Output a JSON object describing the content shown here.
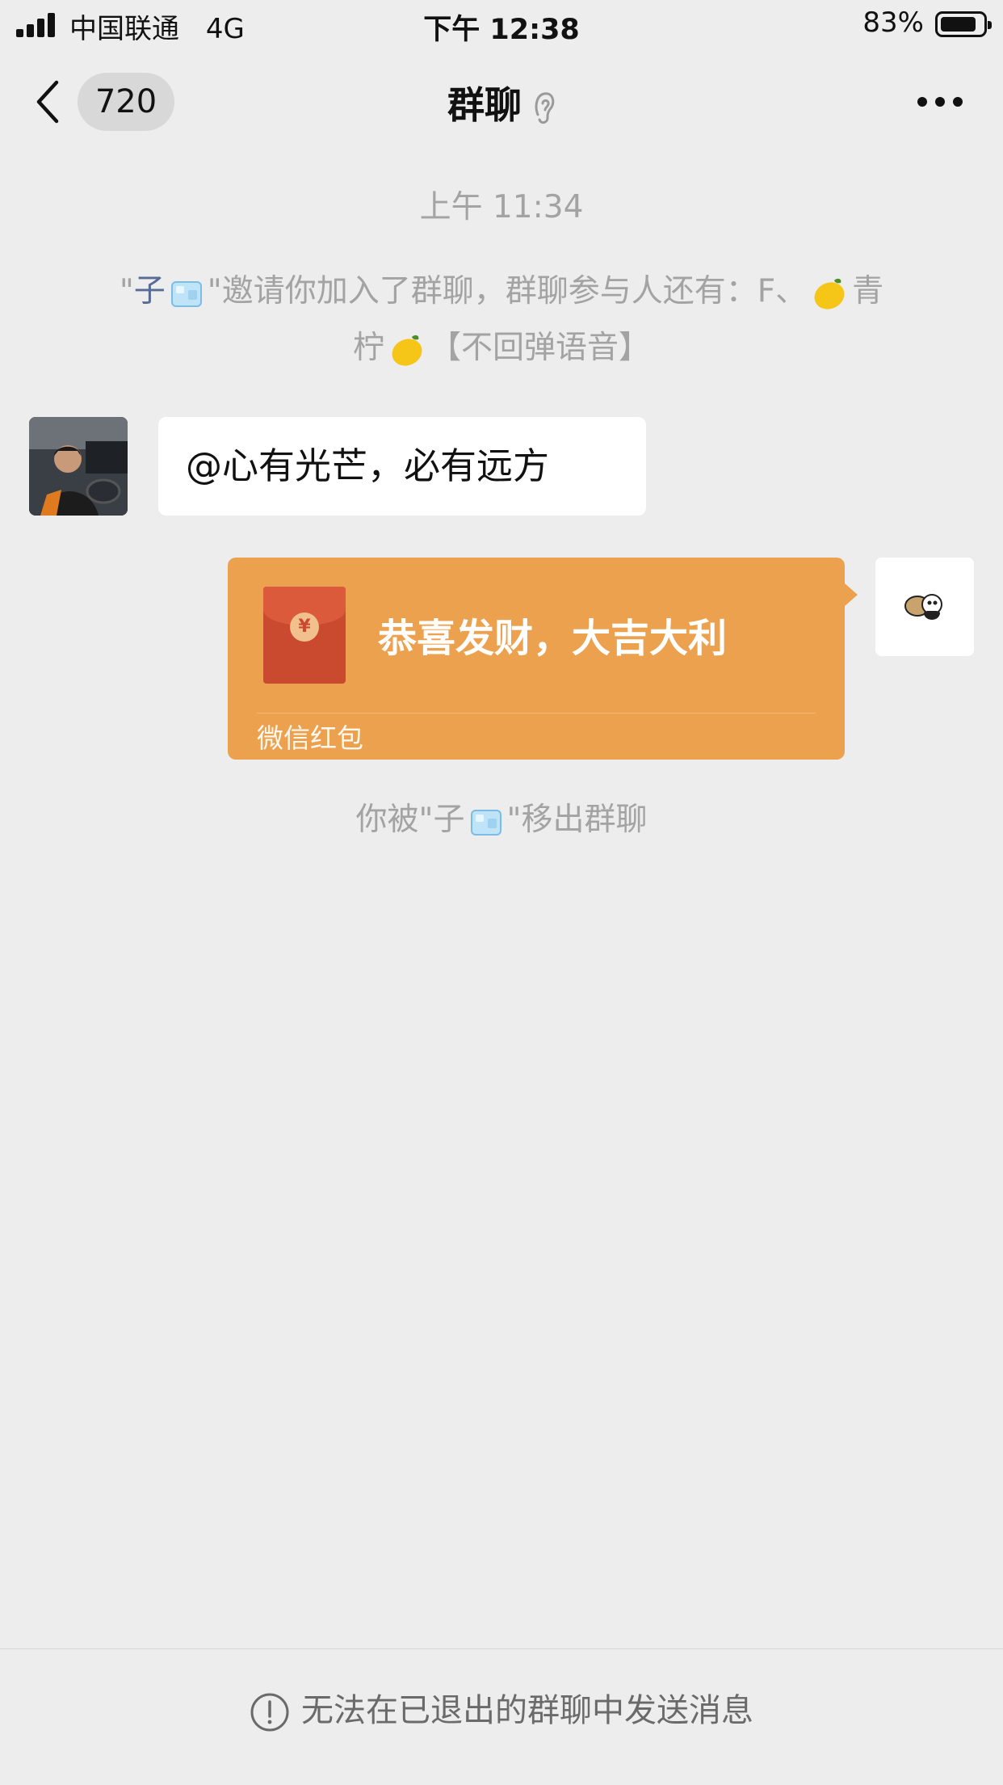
{
  "status_bar": {
    "carrier": "中国联通",
    "network": "4G",
    "time": "下午 12:38",
    "battery": "83%",
    "battery_level": 0.83
  },
  "nav": {
    "back_badge": "720",
    "title": "群聊",
    "title_icon": "ear-icon",
    "more_icon": "more-dots-icon"
  },
  "chat": {
    "timestamp": "上午 11:34",
    "invite": {
      "quote_open": "\"",
      "inviter": "子",
      "quote_close": "\"",
      "text": "邀请你加入了群聊，群聊参与人还有：F、",
      "member_part1": "青",
      "member_part2": "柠",
      "suffix": "【不回弹语音】"
    },
    "messages": [
      {
        "side": "left",
        "text": "@心有光芒，必有远方"
      }
    ],
    "red_packet": {
      "greeting": "恭喜发财，大吉大利",
      "label": "微信红包",
      "coin_symbol": "¥"
    },
    "removed": {
      "prefix": "你被\"子",
      "suffix": "\"移出群聊"
    }
  },
  "bottom_bar": {
    "text": "无法在已退出的群聊中发送消息",
    "icon": "exclamation-circle-icon"
  }
}
